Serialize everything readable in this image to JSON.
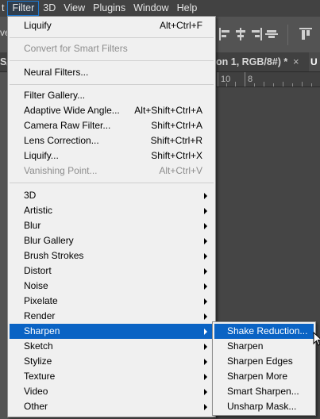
{
  "menubar": {
    "items": [
      {
        "label": "t",
        "active": false
      },
      {
        "label": "Filter",
        "active": true
      },
      {
        "label": "3D",
        "active": false
      },
      {
        "label": "View",
        "active": false
      },
      {
        "label": "Plugins",
        "active": false
      },
      {
        "label": "Window",
        "active": false
      },
      {
        "label": "Help",
        "active": false
      }
    ]
  },
  "optionsbar": {
    "left_fragment": "ve"
  },
  "tabs": {
    "left_fragment": "S/",
    "doc_title": "on 1, RGB/8#) *",
    "close": "×",
    "right_fragment": "U"
  },
  "ruler": {
    "label_1": "10",
    "label_2": "8"
  },
  "filter_menu": {
    "items": [
      {
        "label": "Liquify",
        "shortcut": "Alt+Ctrl+F",
        "disabled": false
      },
      {
        "label": "Convert for Smart Filters",
        "shortcut": "",
        "disabled": true
      },
      {
        "label": "Neural Filters...",
        "shortcut": "",
        "disabled": false
      },
      {
        "label": "Filter Gallery...",
        "shortcut": "",
        "disabled": false
      },
      {
        "label": "Adaptive Wide Angle...",
        "shortcut": "Alt+Shift+Ctrl+A",
        "disabled": false
      },
      {
        "label": "Camera Raw Filter...",
        "shortcut": "Shift+Ctrl+A",
        "disabled": false
      },
      {
        "label": "Lens Correction...",
        "shortcut": "Shift+Ctrl+R",
        "disabled": false
      },
      {
        "label": "Liquify...",
        "shortcut": "Shift+Ctrl+X",
        "disabled": false
      },
      {
        "label": "Vanishing Point...",
        "shortcut": "Alt+Ctrl+V",
        "disabled": true
      },
      {
        "label": "3D",
        "submenu": true
      },
      {
        "label": "Artistic",
        "submenu": true
      },
      {
        "label": "Blur",
        "submenu": true
      },
      {
        "label": "Blur Gallery",
        "submenu": true
      },
      {
        "label": "Brush Strokes",
        "submenu": true
      },
      {
        "label": "Distort",
        "submenu": true
      },
      {
        "label": "Noise",
        "submenu": true
      },
      {
        "label": "Pixelate",
        "submenu": true
      },
      {
        "label": "Render",
        "submenu": true
      },
      {
        "label": "Sharpen",
        "submenu": true,
        "selected": true
      },
      {
        "label": "Sketch",
        "submenu": true
      },
      {
        "label": "Stylize",
        "submenu": true
      },
      {
        "label": "Texture",
        "submenu": true
      },
      {
        "label": "Video",
        "submenu": true
      },
      {
        "label": "Other",
        "submenu": true
      }
    ]
  },
  "sharpen_submenu": {
    "items": [
      {
        "label": "Shake Reduction...",
        "selected": true
      },
      {
        "label": "Sharpen"
      },
      {
        "label": "Sharpen Edges"
      },
      {
        "label": "Sharpen More"
      },
      {
        "label": "Smart Sharpen..."
      },
      {
        "label": "Unsharp Mask..."
      }
    ]
  },
  "colors": {
    "highlight": "#0a63c4",
    "menu_bg": "#f0f0f0",
    "app_bg": "#535353"
  }
}
